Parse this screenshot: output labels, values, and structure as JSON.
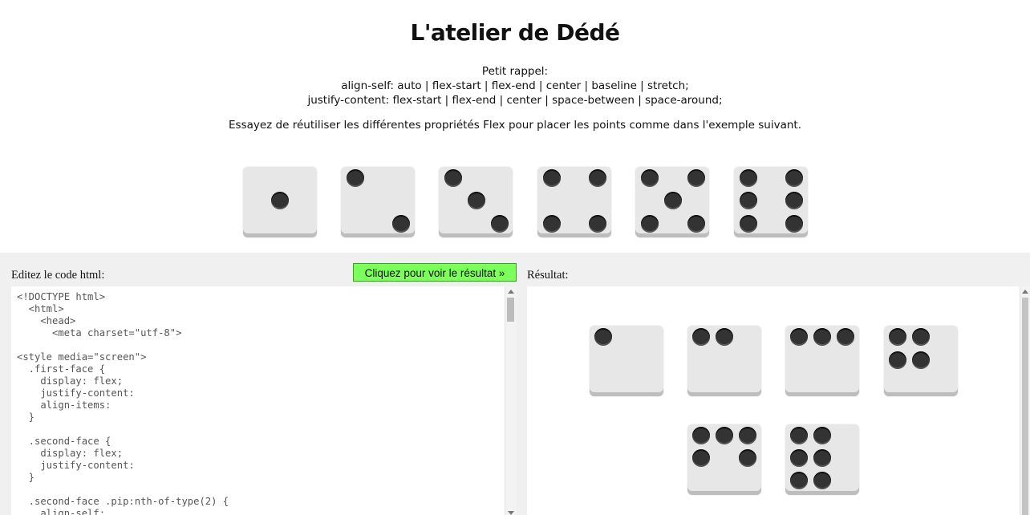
{
  "title": "L'atelier de Dédé",
  "recap": {
    "heading": "Petit rappel:",
    "align_self": "align-self: auto | flex-start | flex-end | center | baseline | stretch;",
    "justify_content": "justify-content: flex-start | flex-end | center | space-between | space-around;"
  },
  "instruction": "Essayez de réutiliser les différentes propriétés Flex pour placer les points comme dans l'exemple suivant.",
  "example_dice": [
    1,
    2,
    3,
    4,
    5,
    6
  ],
  "editor": {
    "label": "Editez le code html:",
    "run_button": "Cliquez pour voir le résultat »",
    "code": "<!DOCTYPE html>\n  <html>\n    <head>\n      <meta charset=\"utf-8\">\n\n<style media=\"screen\">\n  .first-face {\n    display: flex;\n    justify-content:\n    align-items:\n  }\n\n  .second-face {\n    display: flex;\n    justify-content:\n  }\n\n  .second-face .pip:nth-of-type(2) {\n    align-self:"
  },
  "result": {
    "label": "Résultat:",
    "dice": [
      1,
      2,
      3,
      4,
      5,
      6
    ]
  },
  "colors": {
    "die_face": "#e7e7e7",
    "pip": "#333333",
    "run_button": "#7cff5a",
    "workspace_bg": "#f0f0f0"
  }
}
